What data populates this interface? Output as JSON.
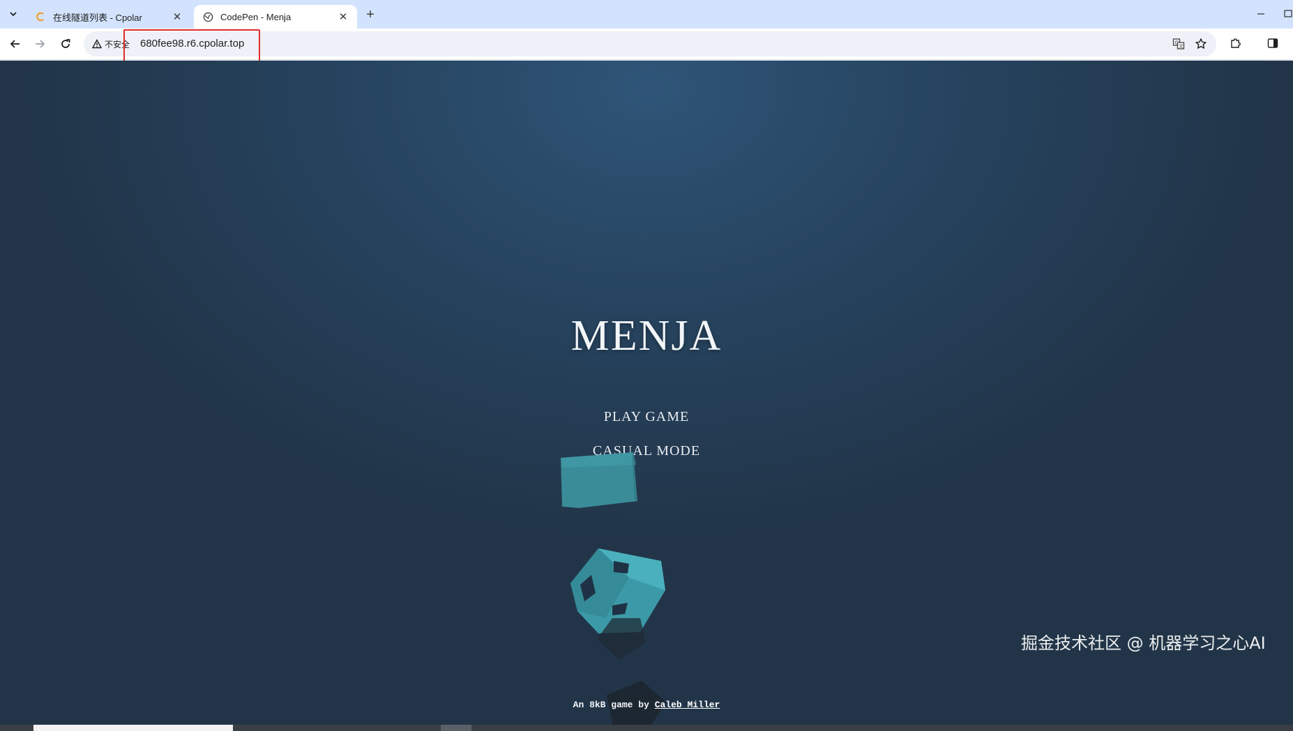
{
  "browser": {
    "tabs": [
      {
        "title": "在线隧道列表 - Cpolar",
        "favicon": "cpolar-c-icon",
        "active": false
      },
      {
        "title": "CodePen - Menja",
        "favicon": "globe-icon",
        "active": true
      }
    ],
    "close_glyph": "✕",
    "new_tab_glyph": "+",
    "security_label": "不安全",
    "url": "680fee98.r6.cpolar.top",
    "highlight_color": "#e22a2a"
  },
  "game": {
    "title": "MENJA",
    "menu": [
      "PLAY GAME",
      "CASUAL MODE"
    ],
    "credit_prefix": "An 8kB game by ",
    "credit_author": "Caleb Miller",
    "cube_color": "#3c9aa8"
  },
  "watermark": "掘金技术社区 @ 机器学习之心AI",
  "colors": {
    "tabstrip": "#d3e3fd",
    "background_top": "#2f5578",
    "background_bottom": "#223548"
  }
}
